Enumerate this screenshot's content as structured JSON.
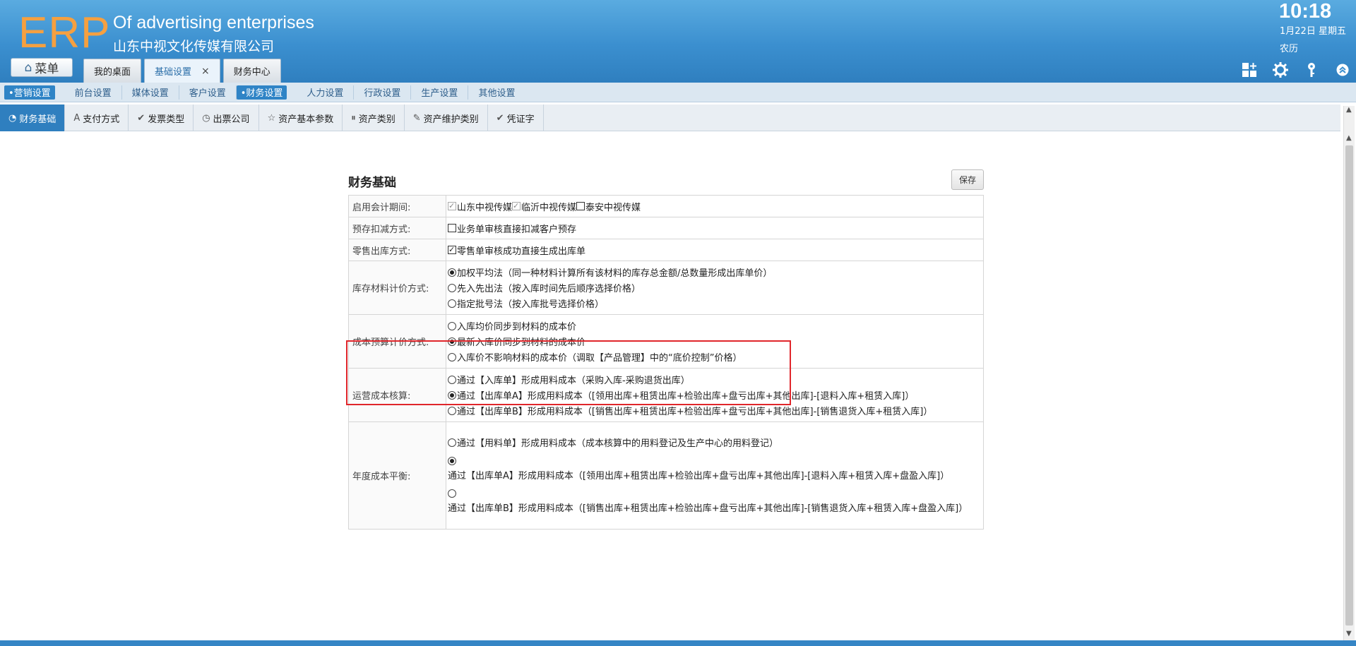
{
  "header": {
    "logo": "ERP",
    "company_en": "Of advertising enterprises",
    "company_cn": "山东中视文化传媒有限公司",
    "time": "10:18",
    "date": "1月22日 星期五",
    "lunar": "农历",
    "menu_label": "菜单",
    "tabs": [
      {
        "label": "我的桌面"
      },
      {
        "label": "基础设置",
        "active": true,
        "close": "×"
      },
      {
        "label": "财务中心"
      }
    ],
    "icons": [
      "grid-add-icon",
      "gear-icon",
      "key-icon",
      "collapse-up-icon"
    ]
  },
  "subnav": {
    "items": [
      {
        "label": "•营销设置",
        "active": true
      },
      {
        "label": "前台设置"
      },
      {
        "label": "媒体设置"
      },
      {
        "label": "客户设置"
      },
      {
        "label": "•财务设置",
        "active": true
      },
      {
        "label": "人力设置"
      },
      {
        "label": "行政设置"
      },
      {
        "label": "生产设置"
      },
      {
        "label": "其他设置"
      }
    ]
  },
  "toolbar": {
    "items": [
      {
        "label": "财务基础",
        "icon": "◔",
        "active": true
      },
      {
        "label": "支付方式",
        "icon": "A"
      },
      {
        "label": "发票类型",
        "icon": "✔"
      },
      {
        "label": "出票公司",
        "icon": "◷"
      },
      {
        "label": "资产基本参数",
        "icon": "☆"
      },
      {
        "label": "资产类别",
        "icon": "⏸"
      },
      {
        "label": "资产维护类别",
        "icon": "✎"
      },
      {
        "label": "凭证字",
        "icon": "✔"
      }
    ]
  },
  "panel": {
    "title": "财务基础",
    "save": "保存",
    "rows": {
      "period": {
        "label": "启用会计期间:",
        "options": [
          {
            "text": "山东中视传媒",
            "checked": true,
            "disabled": true
          },
          {
            "text": "临沂中视传媒",
            "checked": true,
            "disabled": true
          },
          {
            "text": "泰安中视传媒",
            "checked": false
          }
        ]
      },
      "prestore": {
        "label": "预存扣减方式:",
        "text": "业务单审核直接扣减客户预存",
        "checked": false
      },
      "retail": {
        "label": "零售出库方式:",
        "text": "零售单审核成功直接生成出库单",
        "checked": true
      },
      "inventory": {
        "label": "库存材料计价方式:",
        "options": [
          {
            "text": "加权平均法（同一种材料计算所有该材料的库存总金额/总数量形成出库单价）",
            "on": true
          },
          {
            "text": "先入先出法（按入库时间先后顺序选择价格）",
            "on": false
          },
          {
            "text": "指定批号法（按入库批号选择价格）",
            "on": false
          }
        ]
      },
      "budget": {
        "label": "成本预算计价方式:",
        "options": [
          {
            "text": "入库均价同步到材料的成本价",
            "on": false
          },
          {
            "text": "最新入库价同步到材料的成本价",
            "on": true
          },
          {
            "text": "入库价不影响材料的成本价（调取【产品管理】中的“底价控制”价格）",
            "on": false
          }
        ]
      },
      "operating": {
        "label": "运营成本核算:",
        "options": [
          {
            "text": "通过【入库单】形成用料成本（采购入库-采购退货出库）",
            "on": false
          },
          {
            "text": "通过【出库单A】形成用料成本（[领用出库+租赁出库+检验出库+盘亏出库+其他出库]-[退料入库+租赁入库]）",
            "on": true
          },
          {
            "text": "通过【出库单B】形成用料成本（[销售出库+租赁出库+检验出库+盘亏出库+其他出库]-[销售退货入库+租赁入库]）",
            "on": false
          }
        ]
      },
      "annual": {
        "label": "年度成本平衡:",
        "opt1": "通过【用料单】形成用料成本（成本核算中的用料登记及生产中心的用料登记）",
        "opt2": "通过【出库单A】形成用料成本（[领用出库+租赁出库+检验出库+盘亏出库+其他出库]-[退料入库+租赁入库+盘盈入库]）",
        "opt3": "通过【出库单B】形成用料成本（[销售出库+租赁出库+检验出库+盘亏出库+其他出库]-[销售退货入库+租赁入库+盘盈入库]）"
      }
    }
  },
  "colors": {
    "header_blue": "#3b8fcf",
    "logo_orange": "#f5a040",
    "active_blue": "#2f7fbf",
    "highlight_red": "#e0262b"
  }
}
